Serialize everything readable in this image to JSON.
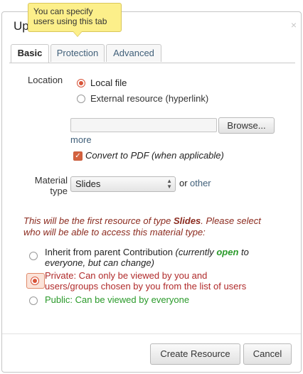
{
  "dialog": {
    "title": "Up",
    "close_glyph": "×"
  },
  "tooltip": {
    "text": "You can specify users using this tab"
  },
  "tabs": [
    {
      "label": "Basic",
      "active": true
    },
    {
      "label": "Protection",
      "active": false
    },
    {
      "label": "Advanced",
      "active": false
    }
  ],
  "location": {
    "label": "Location",
    "options": [
      {
        "label": "Local file",
        "selected": true
      },
      {
        "label": "External resource (hyperlink)",
        "selected": false
      }
    ],
    "file_value": "",
    "browse_label": "Browse...",
    "more_label": "more",
    "convert_label": "Convert to PDF (when applicable)",
    "convert_checked": true
  },
  "material": {
    "label": "Material type",
    "selected": "Slides",
    "or_text": "or",
    "other_label": "other"
  },
  "notice": {
    "prefix": "This will be the first resource of type ",
    "type": "Slides",
    "suffix": ". Please select who will be able to access this material type:"
  },
  "access": {
    "inherit": {
      "text": "Inherit from parent Contribution ",
      "note_prefix": "(currently ",
      "status": "open",
      "note_suffix": " to everyone, but can change)",
      "selected": false
    },
    "private": {
      "text": "Private: Can only be viewed by you and users/groups chosen by you from the list of users",
      "selected": true
    },
    "public": {
      "text": "Public: Can be viewed by everyone",
      "selected": false
    }
  },
  "colors": {
    "accent": "#d8553a",
    "private_text": "#b02a2a",
    "public_text": "#2a9a2a",
    "open_text": "#2a9a2a",
    "link": "#41607a"
  },
  "buttons": {
    "create_label": "Create Resource",
    "cancel_label": "Cancel"
  }
}
